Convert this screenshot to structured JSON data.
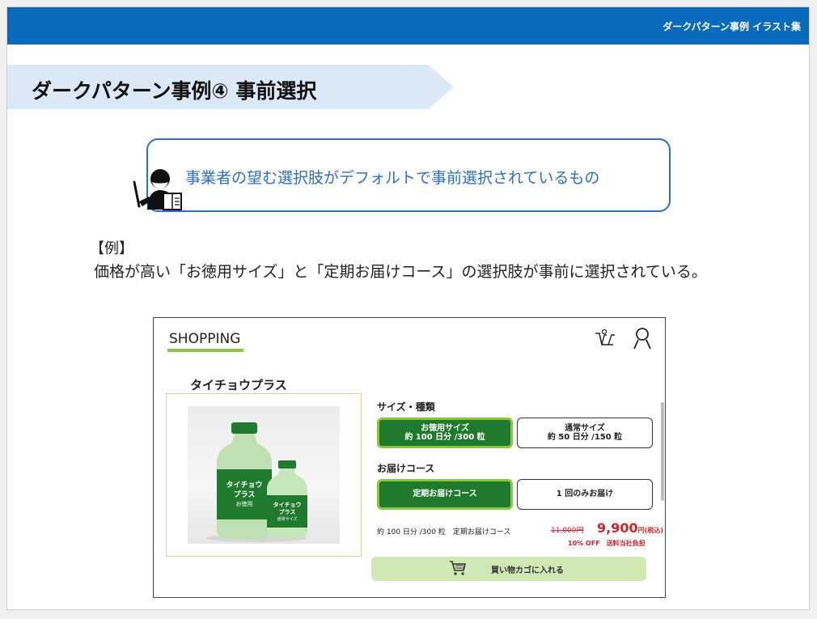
{
  "header": {
    "label": "ダークパターン事例 イラスト集"
  },
  "title": "ダークパターン事例④  事前選択",
  "definition": "事業者の望む選択肢がデフォルトで事前選択されているもの",
  "example": {
    "tag": "【例】",
    "description": "価格が高い「お徳用サイズ」と「定期お届けコース」の選択肢が事前に選択されている。"
  },
  "shop": {
    "logo": "SHOPPING",
    "product_name": "タイチョウプラス",
    "bottle_large_label": [
      "タイチョウ",
      "プラス",
      "お徳用"
    ],
    "bottle_small_label": [
      "タイチョウ",
      "プラス",
      "通常サイズ"
    ],
    "size_heading": "サイズ・種類",
    "size_options": [
      {
        "name": "お徳用サイズ",
        "detail": "約 100 日分 /300 粒",
        "selected": true
      },
      {
        "name": "通常サイズ",
        "detail": "約 50 日分 /150 粒",
        "selected": false
      }
    ],
    "delivery_heading": "お届けコース",
    "delivery_options": [
      {
        "name": "定期お届けコース",
        "selected": true
      },
      {
        "name": "1 回のみお届け",
        "selected": false
      }
    ],
    "summary": "約 100 日分 /300 粒　定期お届けコース",
    "original_price": "11,000円",
    "price": "9,900",
    "price_unit": "円(税込)",
    "discount": "10% OFF　送料当社負担",
    "add_to_cart": "買い物カゴに入れる"
  },
  "colors": {
    "header_blue": "#0a6bbd",
    "title_band": "#dbe8f6",
    "definition_blue": "#2f6fbf",
    "selected_green": "#1f7a2e",
    "selected_border": "#8cc63f",
    "price_red": "#d2232a",
    "cart_button": "#cfe8b4"
  }
}
